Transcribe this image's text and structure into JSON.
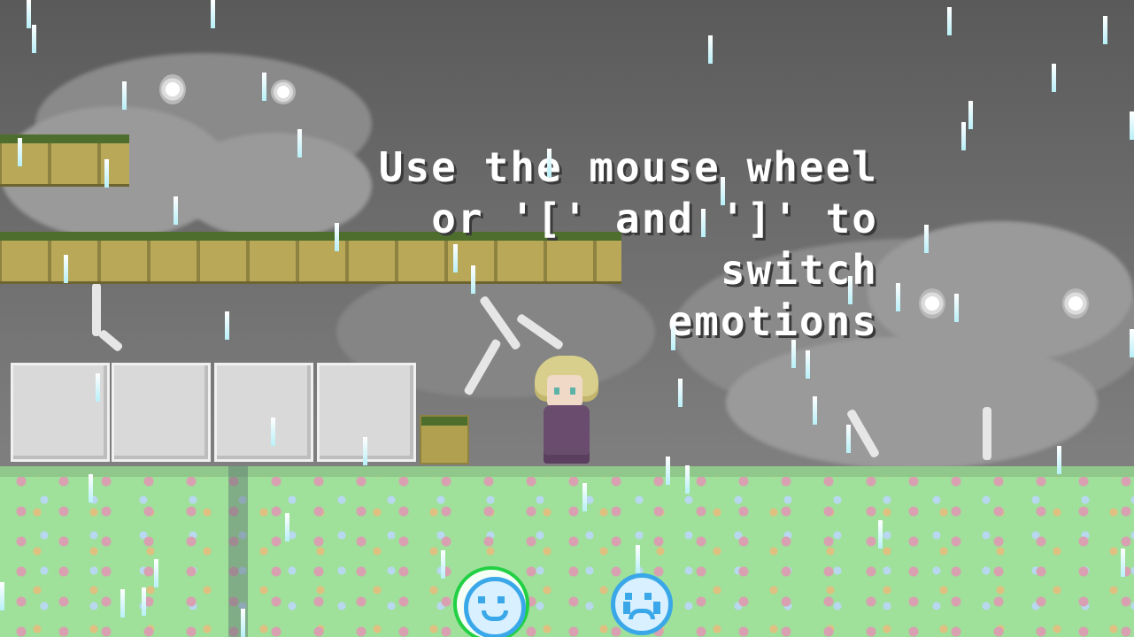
{
  "hint": {
    "line1": "Use the mouse wheel",
    "line2": "or '[' and ']' to switch",
    "line3": "emotions"
  },
  "emotions": [
    {
      "name": "happy",
      "icon": "happy-face-icon",
      "selected": true
    },
    {
      "name": "sad",
      "icon": "crying-face-icon",
      "selected": false
    }
  ],
  "colors": {
    "accent_selected": "#22d044",
    "emote_blue": "#3aa8e8",
    "rain": "#b8f0f8",
    "grass": "#9fe09a"
  }
}
